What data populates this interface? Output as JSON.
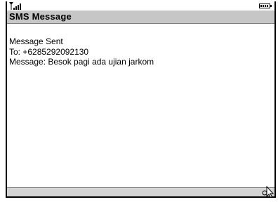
{
  "status": {
    "signal_icon": "antenna-signal-icon",
    "battery_icon": "battery-icon"
  },
  "title": "SMS Message",
  "message": {
    "status_text": "Message Sent",
    "to_line": "To: +6285292092130",
    "body_line": "Message: Besok pagi ada ujian jarkom"
  },
  "soft_bar": {
    "cursor_icon": "mouse-pointer-icon"
  },
  "colors": {
    "title_bar": "#c6c6c6",
    "soft_bar": "#d4d4d4",
    "frame": "#000000"
  }
}
